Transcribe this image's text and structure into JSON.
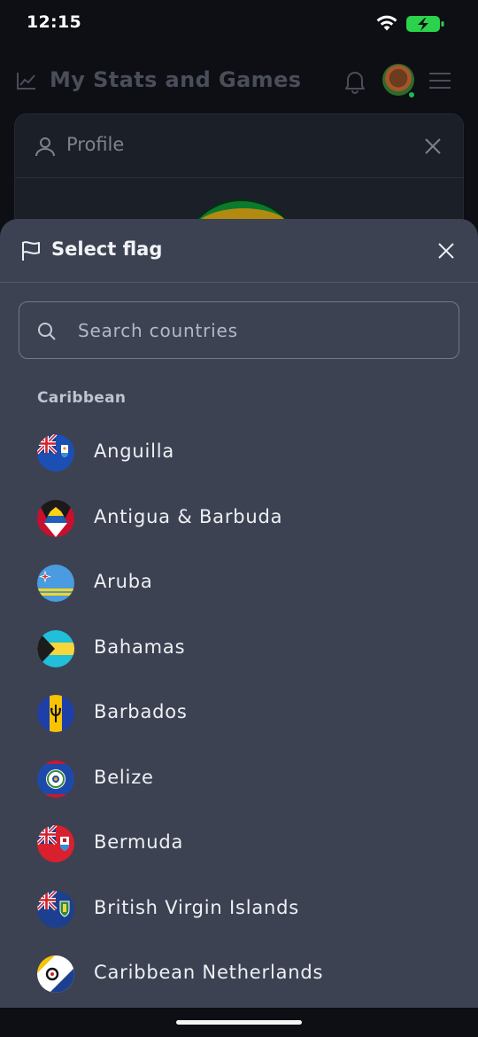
{
  "status_bar": {
    "time": "12:15"
  },
  "app_header": {
    "title": "My Stats and Games"
  },
  "profile_card": {
    "title": "Profile"
  },
  "sheet": {
    "title": "Select flag",
    "search": {
      "placeholder": "Search countries",
      "value": ""
    },
    "section_label": "Caribbean",
    "countries": [
      {
        "name": "Anguilla",
        "flag_icon": "anguilla-flag"
      },
      {
        "name": "Antigua & Barbuda",
        "flag_icon": "antigua-barbuda-flag"
      },
      {
        "name": "Aruba",
        "flag_icon": "aruba-flag"
      },
      {
        "name": "Bahamas",
        "flag_icon": "bahamas-flag"
      },
      {
        "name": "Barbados",
        "flag_icon": "barbados-flag"
      },
      {
        "name": "Belize",
        "flag_icon": "belize-flag"
      },
      {
        "name": "Bermuda",
        "flag_icon": "bermuda-flag"
      },
      {
        "name": "British Virgin Islands",
        "flag_icon": "british-virgin-islands-flag"
      },
      {
        "name": "Caribbean Netherlands",
        "flag_icon": "caribbean-netherlands-flag"
      }
    ]
  },
  "colors": {
    "background": "#0d0f14",
    "sheet": "#3c4252",
    "online": "#1db954",
    "battery": "#2bd24c"
  }
}
